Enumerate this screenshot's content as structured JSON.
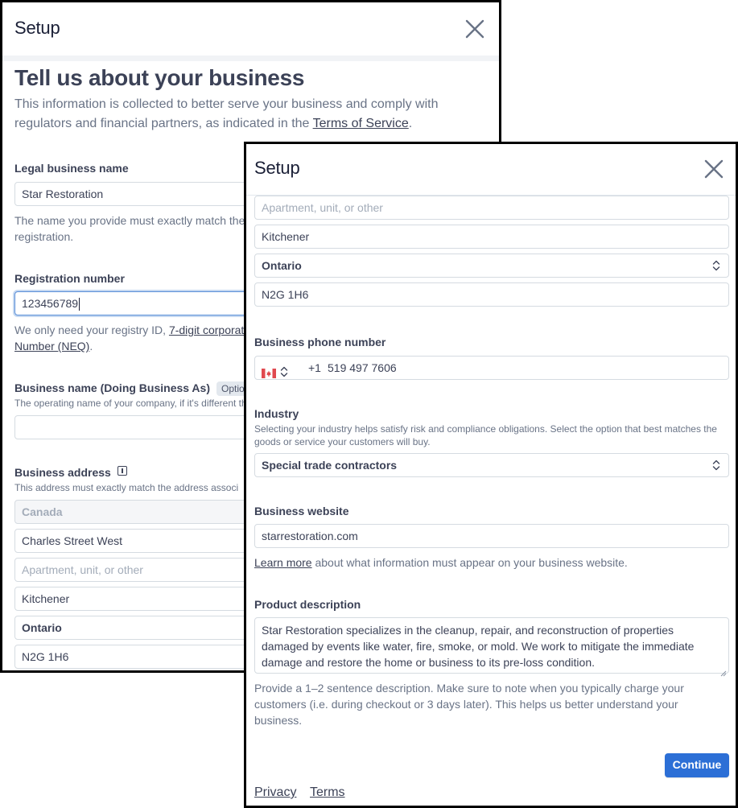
{
  "back": {
    "header_title": "Setup",
    "page_title": "Tell us about your business",
    "intro_text": "This information is collected to better serve your business and comply with",
    "intro_text_line2": "regulators and financial partners, as indicated in the",
    "terms_link": "Terms of Service",
    "intro_end": ".",
    "legal_name": {
      "label": "Legal business name",
      "value": "Star Restoration",
      "help_line1": "The name you provide must exactly match the",
      "help_line2": "registration."
    },
    "registration": {
      "label": "Registration number",
      "value": "123456789",
      "help_prefix": "We only need your registry ID,",
      "help_link1": "7-digit corporat",
      "help_link2": "Number (NEQ)",
      "help_end": "."
    },
    "dba": {
      "label": "Business name (Doing Business As)",
      "badge": "Optio",
      "help": "The operating name of your company, if it's different th",
      "value": ""
    },
    "address": {
      "label": "Business address",
      "help": "This address must exactly match the address associ",
      "country": "Canada",
      "street": "Charles Street West",
      "unit_placeholder": "Apartment, unit, or other",
      "city": "Kitchener",
      "province": "Ontario",
      "postal": "N2G 1H6"
    }
  },
  "front": {
    "header_title": "Setup",
    "unit_placeholder": "Apartment, unit, or other",
    "city": "Kitchener",
    "province": "Ontario",
    "postal": "N2G 1H6",
    "phone": {
      "label": "Business phone number",
      "code": "+1",
      "number": "519 497 7606"
    },
    "industry": {
      "label": "Industry",
      "help_line1": "Selecting your industry helps satisfy risk and compliance obligations. Select the option that best matches the",
      "help_line2": "goods or service your customers will buy.",
      "value": "Special trade contractors"
    },
    "website": {
      "label": "Business website",
      "value": "starrestoration.com",
      "learn_more": "Learn more",
      "help_rest": "about what information must appear on your business website."
    },
    "product": {
      "label": "Product description",
      "line1": "Star Restoration specializes in the cleanup, repair, and reconstruction of properties",
      "line2": "damaged by events like water, fire, smoke, or mold. We work to mitigate the immediate",
      "line3": "damage and restore the home or business to its pre-loss condition.",
      "help_line1": "Provide a 1–2 sentence description. Make sure to note when you typically charge your",
      "help_line2": "customers (i.e. during checkout or 3 days later). This helps us better understand your",
      "help_line3": "business."
    },
    "continue_label": "Continue",
    "privacy": "Privacy",
    "terms": "Terms"
  },
  "colors": {
    "primary": "#2c6fd6",
    "text": "#3c4257",
    "muted": "#697386",
    "border": "#d5dbe1"
  }
}
